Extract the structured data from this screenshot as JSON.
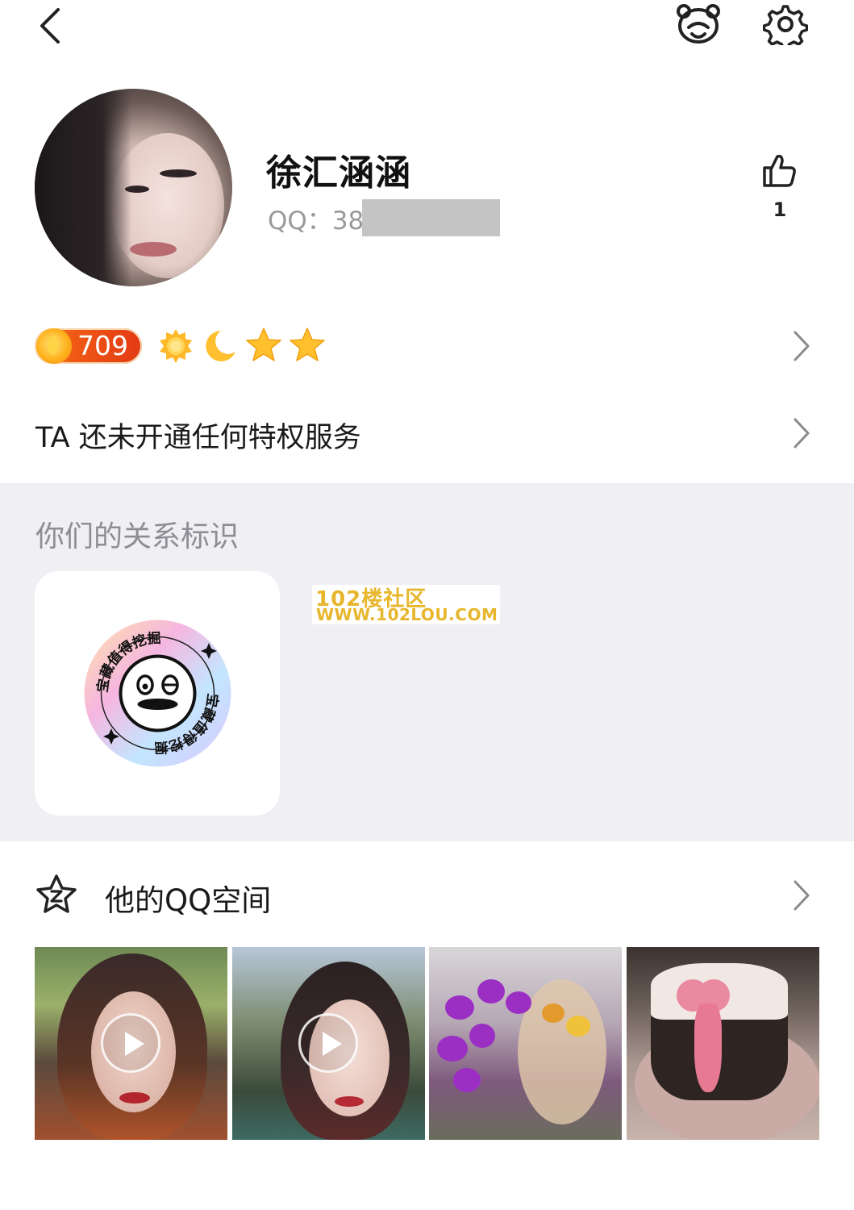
{
  "header": {
    "back_icon": "chevron-left-icon",
    "bear_icon": "bear-face-icon",
    "settings_icon": "gear-icon"
  },
  "profile": {
    "name": "徐汇涵涵",
    "qq_label": "QQ：38",
    "like_count": "1",
    "like_icon": "thumbs-up-icon"
  },
  "level": {
    "value": "709",
    "icons": [
      "sun-icon",
      "moon-icon",
      "star-icon",
      "star-icon"
    ]
  },
  "privilege": {
    "text": "TA 还未开通任何特权服务"
  },
  "relationship": {
    "title": "你们的关系标识",
    "badge_text": "宝藏值得挖掘"
  },
  "watermark": {
    "line1": "102楼社区",
    "line2": "WWW.102LOU.COM"
  },
  "qzone": {
    "title": "他的QQ空间",
    "photos": [
      "video",
      "video",
      "photo",
      "photo"
    ]
  },
  "colors": {
    "accent_orange": "#f05a14",
    "section_bg": "#efeff4",
    "watermark": "#e8b62c"
  }
}
